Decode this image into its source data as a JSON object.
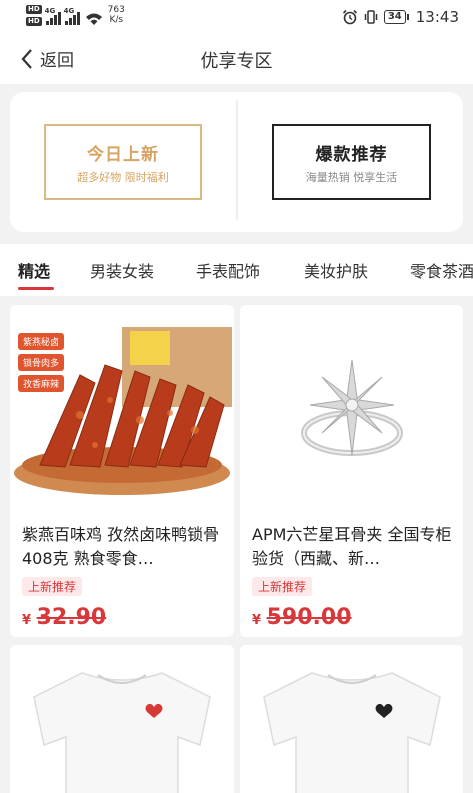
{
  "status_bar": {
    "sim1": "HD",
    "sim2": "HD",
    "net1": "4G",
    "net2": "4G",
    "speed_value": "763",
    "speed_unit": "K/s",
    "battery": "34",
    "time": "13:43"
  },
  "header": {
    "back_label": "返回",
    "title": "优享专区"
  },
  "promos": [
    {
      "title": "今日上新",
      "subtitle": "超多好物 限时福利"
    },
    {
      "title": "爆款推荐",
      "subtitle": "海量热销 悦享生活"
    }
  ],
  "tabs": [
    "精选",
    "男装女装",
    "手表配饰",
    "美妆护肤",
    "零食茶酒"
  ],
  "products": [
    {
      "title": "紫燕百味鸡 孜然卤味鸭锁骨408克 熟食零食…",
      "badge": "上新推荐",
      "currency": "¥",
      "price": "32.90",
      "image_tags": [
        "紫燕秘卤",
        "锁骨肉多",
        "孜香麻辣"
      ],
      "image": "fried-duck-collarbone"
    },
    {
      "title": "APM六芒星耳骨夹 全国专柜验货（西藏、新…",
      "badge": "上新推荐",
      "currency": "¥",
      "price": "590.00",
      "image": "star-ring"
    },
    {
      "image": "white-tshirt-red-heart"
    },
    {
      "image": "white-tshirt-black-heart"
    }
  ],
  "colors": {
    "accent": "#d8383a",
    "gold": "#d7a463",
    "background": "#f2f2f2"
  }
}
